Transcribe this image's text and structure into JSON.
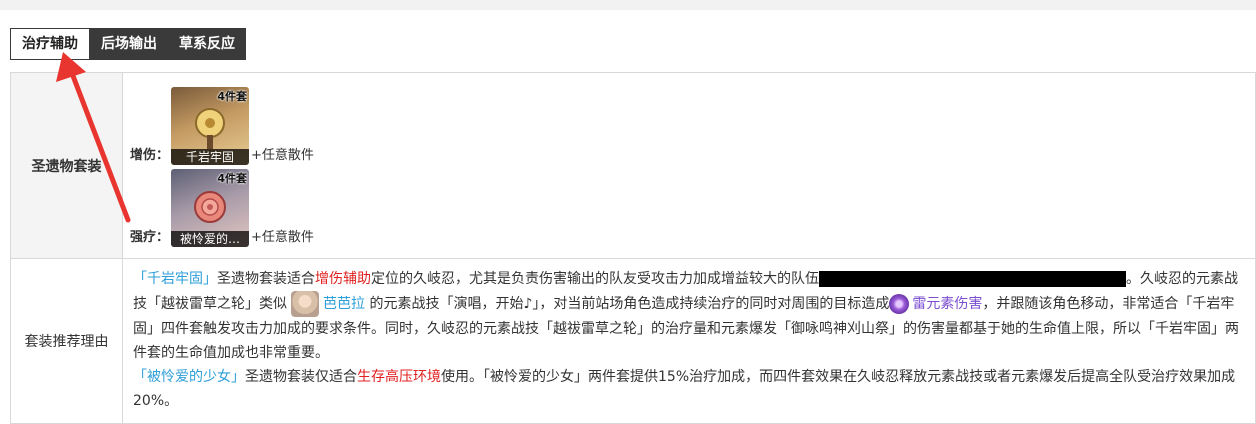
{
  "tabs": [
    "治疗辅助",
    "后场输出",
    "草系反应"
  ],
  "row1": {
    "label": "圣遗物套装",
    "set1": {
      "key": "增伤：",
      "badge": "4件套",
      "name": "千岩牢固",
      "extra": "+任意散件"
    },
    "set2": {
      "key": "强疗：",
      "badge": "4件套",
      "name": "被怜爱的…",
      "extra": "+任意散件"
    }
  },
  "row2": {
    "label": "套装推荐理由",
    "p1": {
      "q1": "「千岩牢固」",
      "a1": "圣遗物套装适合",
      "red1": "增伤辅助",
      "a2": "定位的久岐忍，尤其是负责伤害输出的队友受攻击力加成增益较大的队伍",
      "a3": "。久岐忍的元素战技「越祓雷草之轮」类似",
      "link1": "芭芭拉",
      "a4": "的元素战技「演唱，开始♪」，对当前站场角色造成持续治疗的同时对周围的目标造成",
      "link2": "雷元素伤害",
      "a5": "，并跟随该角色移动，非常适合「千岩牢固」四件套触发攻击力加成的要求条件。同时，久岐忍的元素战技「越祓雷草之轮」的治疗量和元素爆发「御咏鸣神刈山祭」的伤害量都基于她的生命值上限，所以「千岩牢固」两件套的生命值加成也非常重要。"
    },
    "p2": {
      "q1": "「被怜爱的少女」",
      "a1": "圣遗物套装仅适合",
      "red1": "生存高压环境",
      "a2": "使用。「被怜爱的少女」两件套提供15%治疗加成，而四件套效果在久岐忍释放元素战技或者元素爆发后提高全队受治疗效果加成20%。"
    }
  },
  "colors": {
    "tab_dark": "#3a3a3a",
    "link": "#2e9fd8",
    "highlight": "#e02020",
    "electro": "#7b4fd0",
    "arrow": "#e8352f"
  }
}
